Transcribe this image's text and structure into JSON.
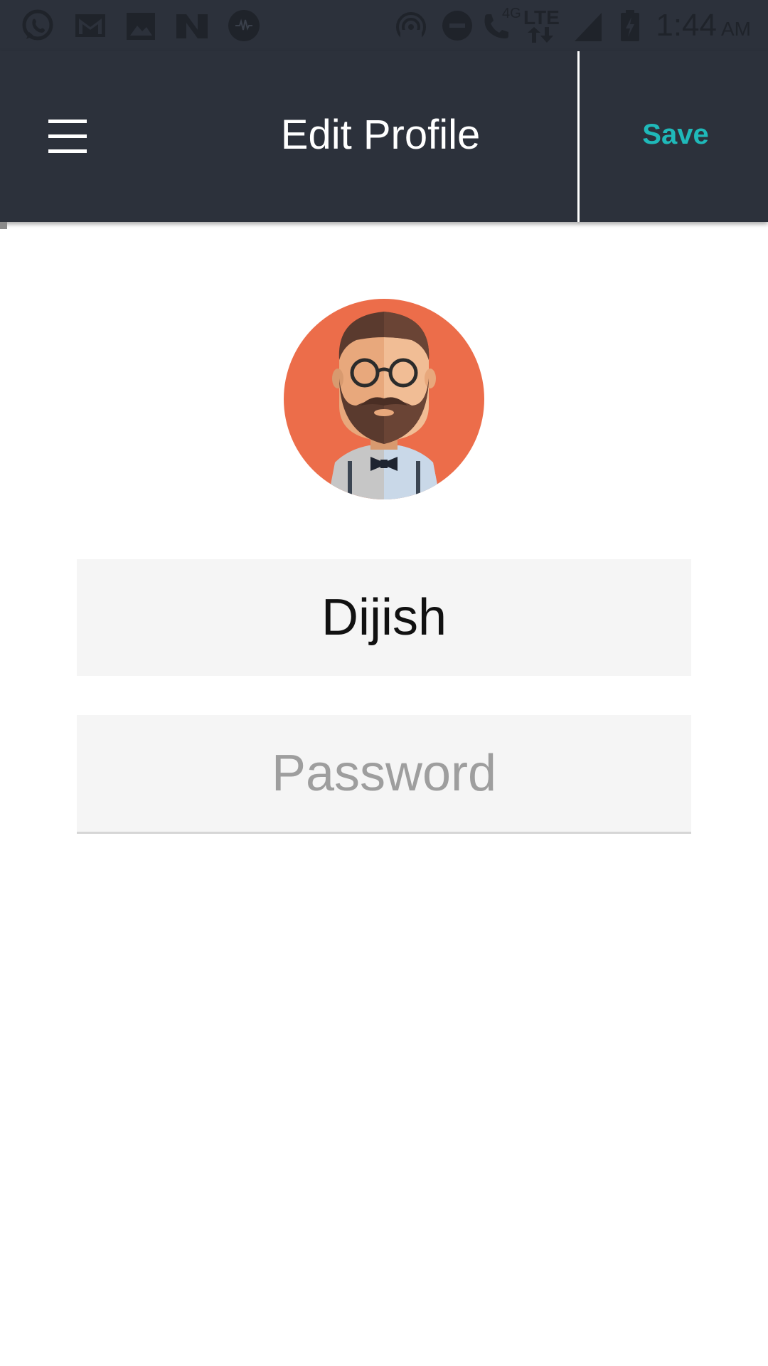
{
  "status_bar": {
    "icons_left": [
      "whatsapp-icon",
      "gmail-icon",
      "gallery-icon",
      "n-app-icon",
      "voice-app-icon"
    ],
    "icons_right": [
      "hotspot-icon",
      "do-not-disturb-icon",
      "volte-call-icon",
      "lte-data-icon",
      "signal-icon",
      "battery-charging-icon"
    ],
    "network_label": "4G",
    "lte_label": "LTE",
    "time": "1:44",
    "ampm": "AM"
  },
  "app_bar": {
    "title": "Edit Profile",
    "menu_icon": "hamburger-menu-icon",
    "save_label": "Save"
  },
  "profile": {
    "avatar": "bearded-man-avatar",
    "name_value": "Dijish",
    "password_placeholder": "Password"
  },
  "colors": {
    "app_bar_bg": "#2c313b",
    "accent": "#1fb9b9",
    "avatar_bg": "#ec6d4a",
    "field_bg": "#f5f5f5"
  }
}
